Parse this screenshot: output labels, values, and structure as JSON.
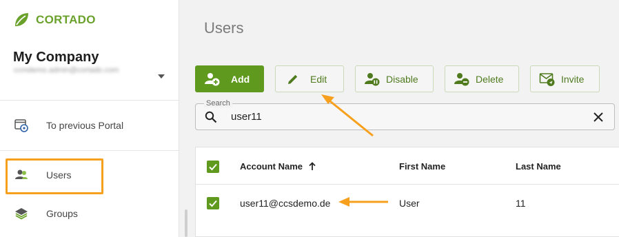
{
  "brand": {
    "name": "CORTADO",
    "color": "#6aa12a"
  },
  "account": {
    "company": "My Company",
    "email": "ccmdemo.admin@cortado.com"
  },
  "sidebar": {
    "items": [
      {
        "label": "To previous Portal",
        "icon": "portal-settings-icon"
      },
      {
        "label": "Users",
        "icon": "users-icon"
      },
      {
        "label": "Groups",
        "icon": "layers-icon"
      }
    ]
  },
  "page": {
    "title": "Users"
  },
  "toolbar": {
    "add": "Add",
    "edit": "Edit",
    "disable": "Disable",
    "delete": "Delete",
    "invite": "Invite"
  },
  "search": {
    "legend": "Search",
    "value": "user11"
  },
  "table": {
    "columns": [
      "Account Name",
      "First Name",
      "Last Name"
    ],
    "sort": {
      "column": "Account Name",
      "direction": "ascending"
    },
    "rows": [
      {
        "account": "user11@ccsdemo.de",
        "first": "User",
        "last": "11",
        "selected": true
      }
    ]
  },
  "colors": {
    "accent": "#5f9a1f",
    "annotation": "#f7a01e"
  }
}
